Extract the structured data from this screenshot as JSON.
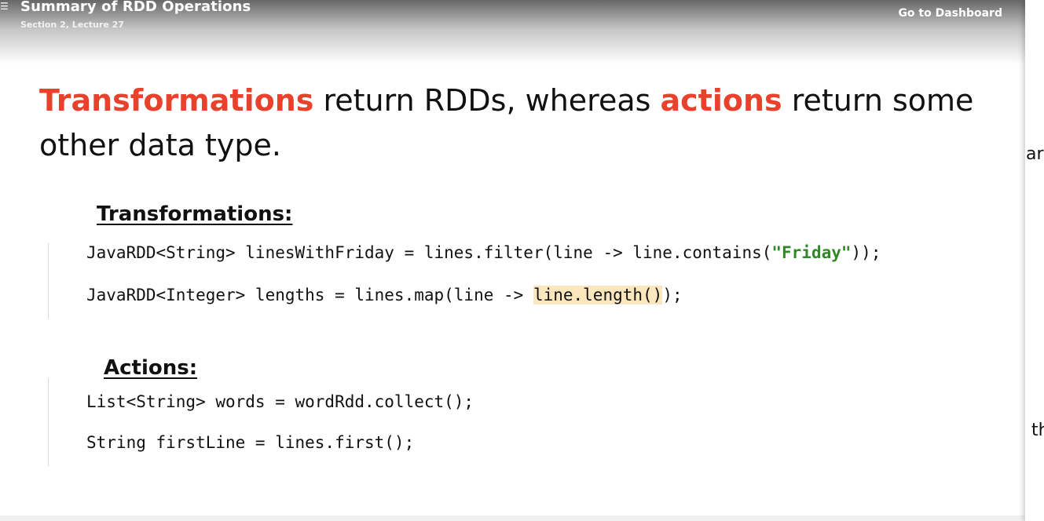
{
  "header": {
    "menu_icon": "hamburger-icon",
    "title": "Summary of RDD Operations",
    "subtitle": "Section 2, Lecture 27",
    "dashboard_link": "Go to Dashboard"
  },
  "slide": {
    "heading": {
      "word_transformations": "Transformations",
      "mid_text": " return RDDs, whereas ",
      "word_actions": "actions",
      "end_text": " return some",
      "line2": "other data type."
    },
    "transformations": {
      "title": "Transformations:",
      "line1": {
        "prefix": "JavaRDD<String> linesWithFriday = lines.filter(line -> line.contains(",
        "string": "\"Friday\"",
        "suffix": "));"
      },
      "line2": {
        "prefix": "JavaRDD<Integer> lengths = lines.map(line -> ",
        "highlight": "line.length()",
        "suffix": ");"
      }
    },
    "actions": {
      "title": "Actions:",
      "line1": "List<String> words = wordRdd.collect();",
      "line2": "String firstLine = lines.first();"
    }
  },
  "side_panel": {
    "text1": "ar",
    "text2": "th"
  },
  "colors": {
    "accent_red": "#e8412c",
    "string_green": "#2f8a25",
    "highlight": "#fbe7bd"
  }
}
